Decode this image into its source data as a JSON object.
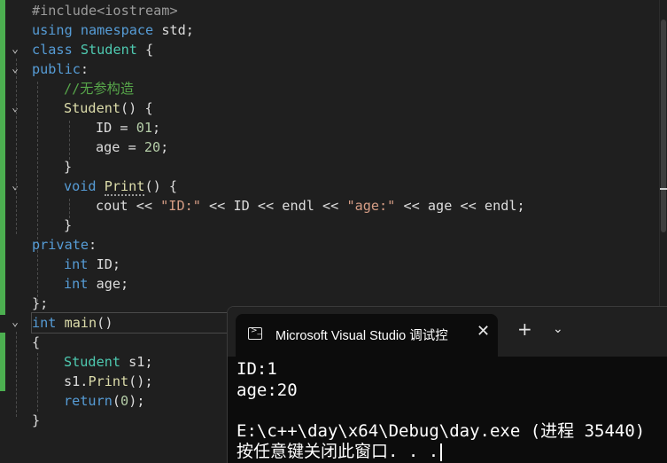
{
  "editor": {
    "code": {
      "l1": "#include<iostream>",
      "l2_kw1": "using",
      "l2_kw2": "namespace",
      "l2_rest": " std;",
      "l3_kw": "class",
      "l3_ty": "Student",
      "l3_rest": " {",
      "l4_kw": "public",
      "l4_rest": ":",
      "l5_comment": "//无参构造",
      "l6_fn": "Student",
      "l6_rest": "() {",
      "l7": "ID = ",
      "l7_num": "01",
      "l7_end": ";",
      "l8": "age = ",
      "l8_num": "20",
      "l8_end": ";",
      "l9": "}",
      "l10_kw": "void",
      "l10_fn": "Print",
      "l10_rest": "() {",
      "l11_a": "cout << ",
      "l11_s1": "\"ID:\"",
      "l11_b": " << ID << endl << ",
      "l11_s2": "\"age:\"",
      "l11_c": " << age << endl;",
      "l12": "}",
      "l13_kw": "private",
      "l13_rest": ":",
      "l14_kw": "int",
      "l14_rest": " ID;",
      "l15_kw": "int",
      "l15_rest": " age;",
      "l16": "};",
      "l17_kw": "int",
      "l17_fn": "main",
      "l17_rest": "()",
      "l18": "{",
      "l19_ty": "Student",
      "l19_rest": " s1;",
      "l20_a": "s1.",
      "l20_fn": "Print",
      "l20_rest": "();",
      "l21_kw": "return",
      "l21_p": "(",
      "l21_num": "0",
      "l21_rest": ");",
      "l22": "}"
    }
  },
  "console": {
    "tab_title": "Microsoft Visual Studio 调试控",
    "tab_icon": "terminal-icon",
    "output": [
      "ID:1",
      "age:20",
      "",
      "E:\\c++\\day\\x64\\Debug\\day.exe (进程 35440)",
      "按任意键关闭此窗口. . ."
    ]
  },
  "colors": {
    "keyword": "#569cd6",
    "type": "#4ec9b0",
    "function": "#dcdcaa",
    "string": "#d69d85",
    "number": "#b5cea8",
    "comment": "#57a64a",
    "change_bar": "#4caf50"
  }
}
